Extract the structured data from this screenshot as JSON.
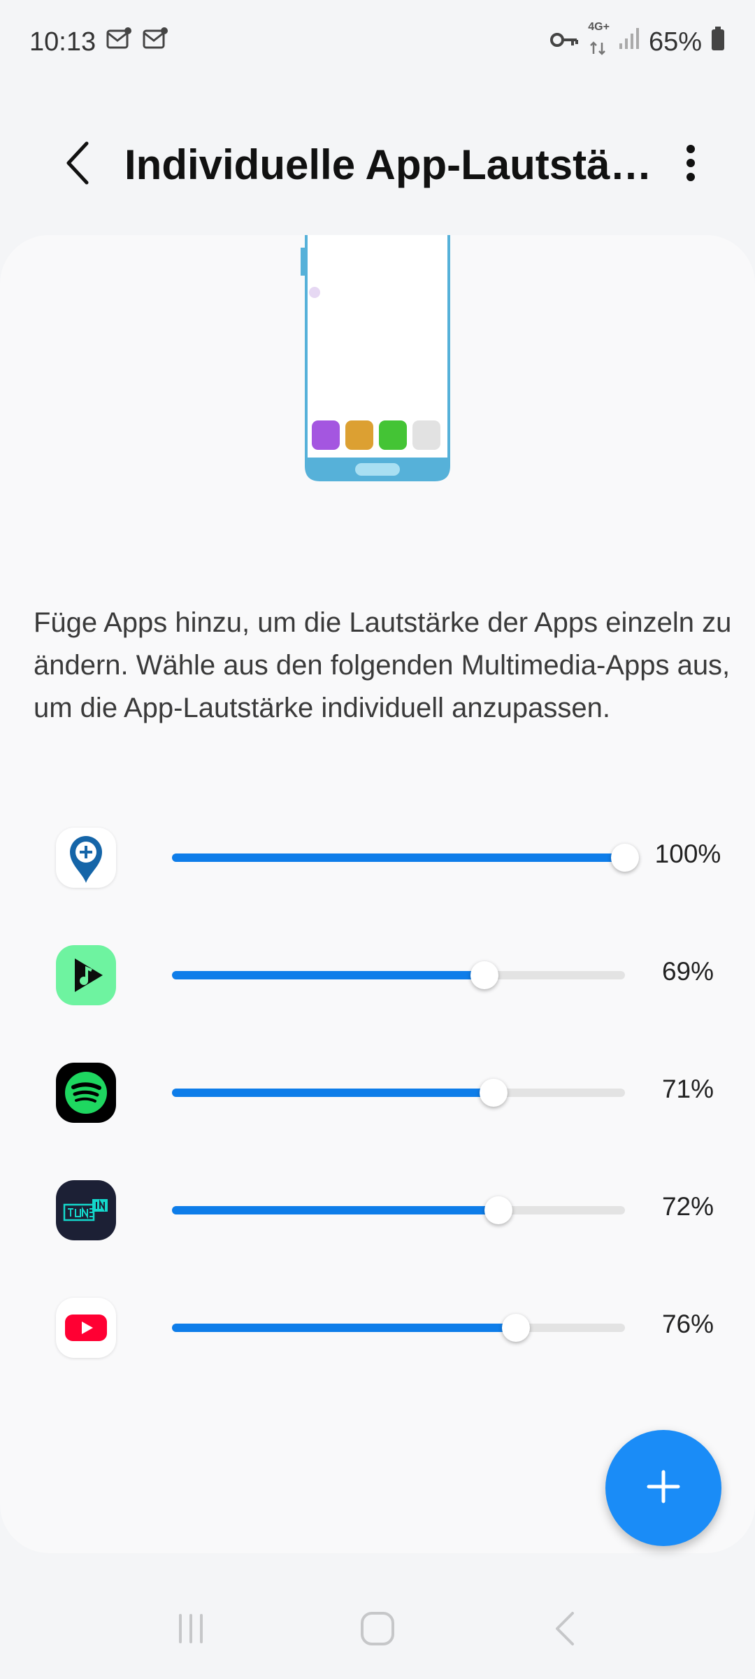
{
  "status_bar": {
    "time": "10:13",
    "notification_icons": [
      "mail-icon",
      "mail-icon"
    ],
    "network_label_top": "4G+",
    "battery_percent": "65%"
  },
  "header": {
    "title": "Individuelle App-Lautstärke",
    "back_icon": "chevron-left-icon",
    "more_icon": "more-vertical-icon"
  },
  "description": "Füge Apps hinzu, um die Lautstärke der Apps einzeln zu ändern. Wähle aus den folgenden Multimedia-Apps aus, um die App-Lautstärke individuell anzupassen.",
  "apps": [
    {
      "icon": "location-pin-icon",
      "volume": 1.0,
      "label": "100%"
    },
    {
      "icon": "music-play-icon",
      "volume": 0.69,
      "label": "69%"
    },
    {
      "icon": "spotify-icon",
      "volume": 0.71,
      "label": "71%"
    },
    {
      "icon": "tunein-icon",
      "volume": 0.72,
      "label": "72%"
    },
    {
      "icon": "youtube-icon",
      "volume": 0.76,
      "label": "76%"
    }
  ],
  "colors": {
    "accent": "#0e7de9",
    "fab": "#1a8cf7"
  },
  "fab_icon": "plus-icon",
  "nav": [
    "recents-icon",
    "home-icon",
    "back-icon"
  ]
}
